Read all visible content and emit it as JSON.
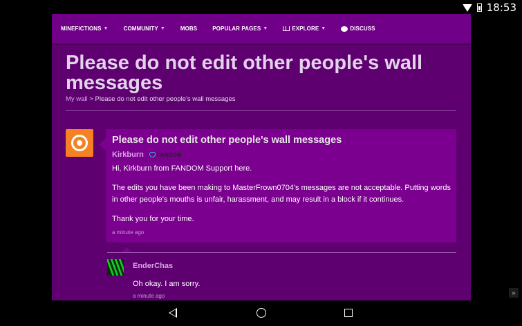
{
  "status_bar": {
    "time": "18:53"
  },
  "nav": {
    "items": [
      {
        "label": "MINEFICTIONS",
        "dropdown": true
      },
      {
        "label": "COMMUNITY",
        "dropdown": true
      },
      {
        "label": "MOBS",
        "dropdown": false
      },
      {
        "label": "POPULAR PAGES",
        "dropdown": true
      },
      {
        "label": "EXPLORE",
        "dropdown": true
      },
      {
        "label": "DISCUSS",
        "dropdown": false
      }
    ]
  },
  "page": {
    "title": "Please do not edit other people's wall messages",
    "breadcrumb": {
      "link": "My wall",
      "separator": ">",
      "current": "Please do not edit other people's wall messages"
    }
  },
  "message": {
    "title": "Please do not edit other people's wall messages",
    "author": "Kirkburn",
    "badge": "FANDOM",
    "body": [
      "Hi, Kirkburn from FANDOM Support here.",
      "The edits you have been making to MasterFrown0704's messages are not acceptable. Putting words in other people's mouths is unfair, harassment, and may result in a block if it continues.",
      "Thank you for your time."
    ],
    "time": "a minute ago"
  },
  "reply": {
    "author": "EnderChas",
    "body": "Oh okay. I am sorry.",
    "time": "a minute ago"
  },
  "icons": {
    "scroll_top": "»",
    "caret": "▼"
  },
  "colors": {
    "page_bg": "#5e0070",
    "nav_bg": "#710089",
    "card_bg": "#7b008f",
    "link": "#d8a5e5"
  }
}
